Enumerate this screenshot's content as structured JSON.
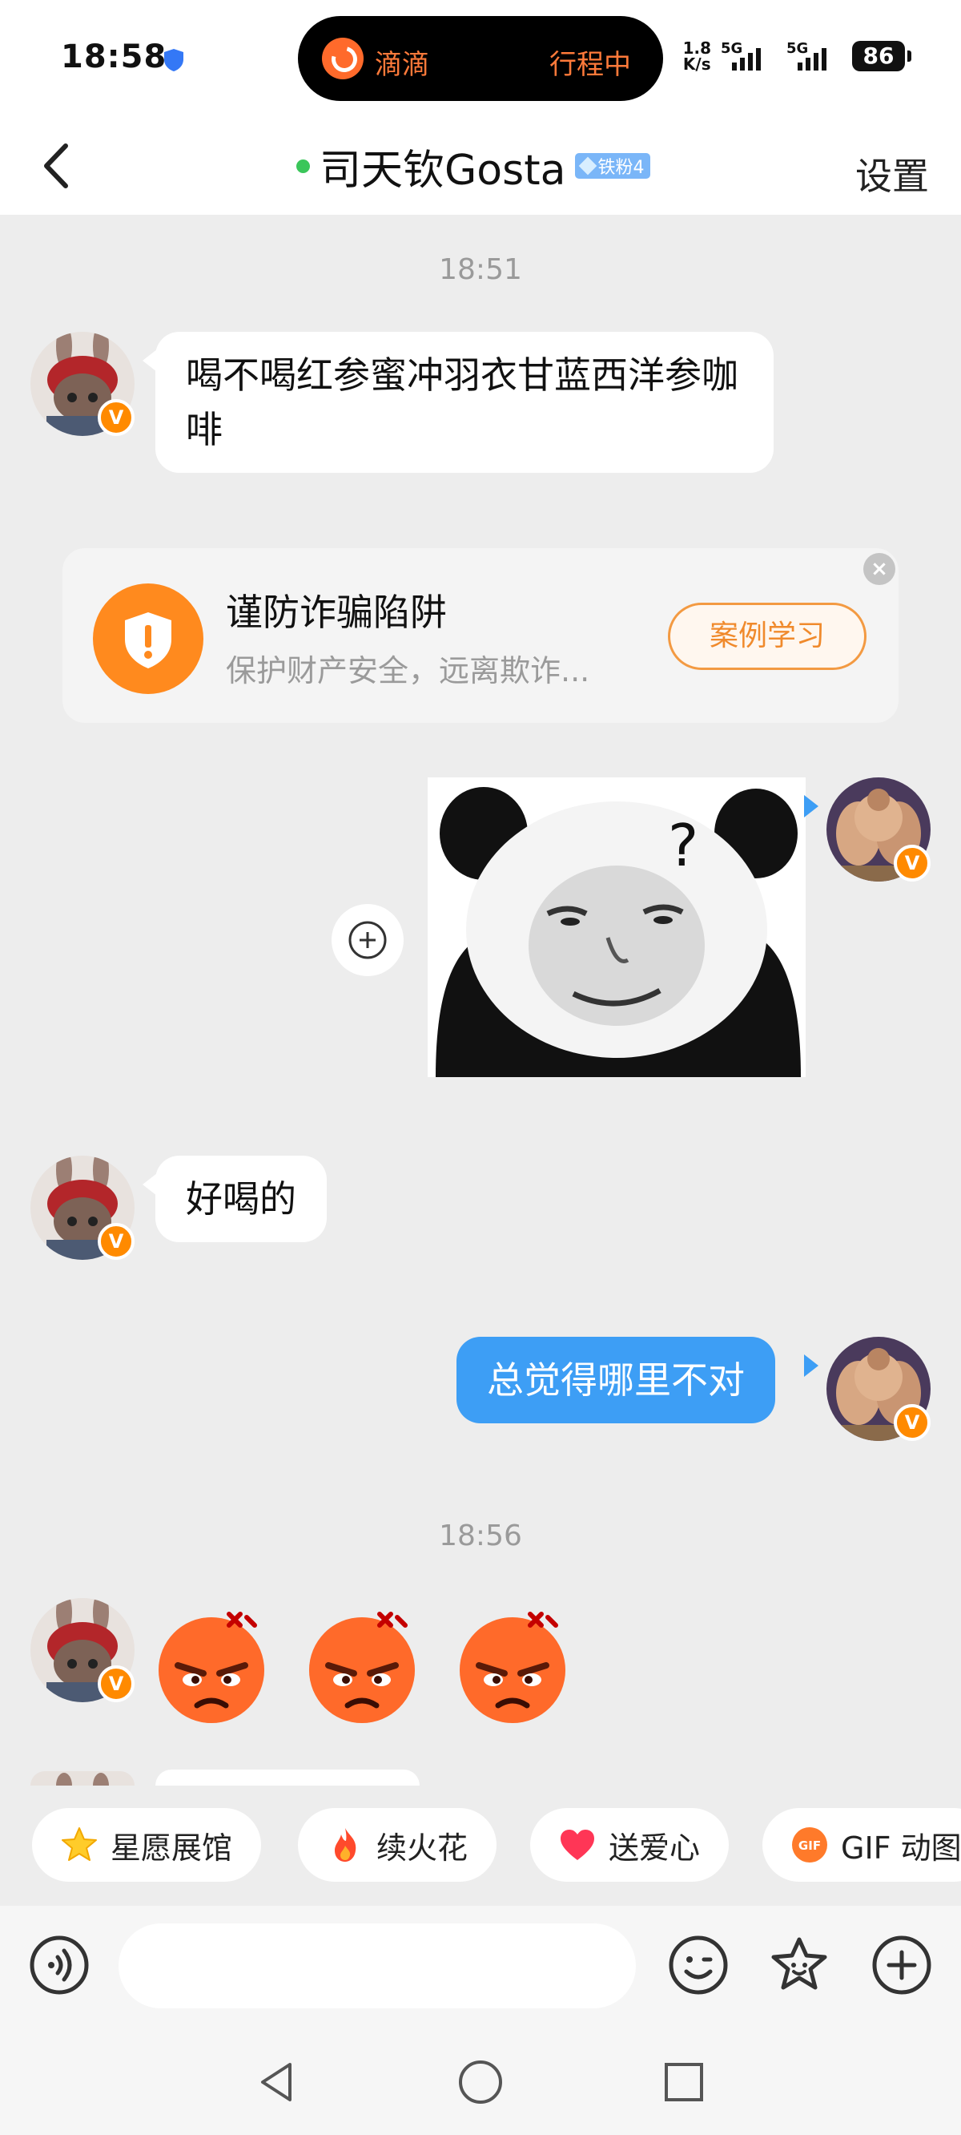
{
  "status_bar": {
    "time": "18:58",
    "island_app": "滴滴",
    "island_status": "行程中",
    "net_speed_value": "1.8",
    "net_speed_unit": "K/s",
    "network_label": "5G",
    "battery": "86"
  },
  "header": {
    "title": "司天钦Gosta",
    "fan_badge": "铁粉4",
    "settings_label": "设置"
  },
  "chat": {
    "timestamp_1": "18:51",
    "msg_1": "喝不喝红参蜜冲羽衣甘蓝西洋参咖啡",
    "notice": {
      "title": "谨防诈骗陷阱",
      "subtitle": "保护财产安全，远离欺诈...",
      "button": "案例学习"
    },
    "msg_3": "好喝的",
    "msg_4": "总觉得哪里不对",
    "timestamp_2": "18:56"
  },
  "quick_actions": [
    {
      "label": "星愿展馆",
      "icon": "star-icon"
    },
    {
      "label": "续火花",
      "icon": "flame-icon"
    },
    {
      "label": "送爱心",
      "icon": "heart-icon"
    },
    {
      "label": "GIF 动图",
      "icon": "gif-icon"
    }
  ],
  "gif_icon_text": "GIF",
  "verified_mark": "V",
  "input": {
    "placeholder": ""
  },
  "colors": {
    "accent_blue": "#3d9ef5",
    "orange": "#ff8a1e",
    "background": "#ededed"
  }
}
